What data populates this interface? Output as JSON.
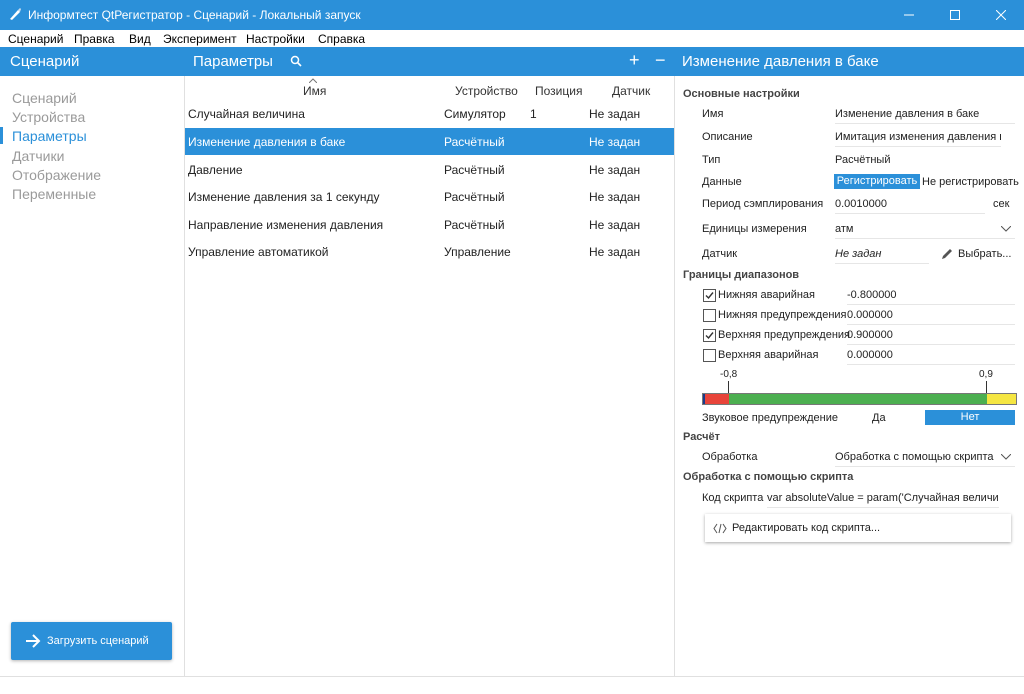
{
  "window": {
    "title": "Информтест QtРегистратор - Сценарий - Локальный запуск"
  },
  "menu": [
    "Сценарий",
    "Правка",
    "Вид",
    "Эксперимент",
    "Настройки",
    "Справка"
  ],
  "header": {
    "left_title": "Сценарий",
    "middle_title": "Параметры",
    "right_title": "Изменение давления в баке",
    "add_symbol": "+",
    "remove_symbol": "−"
  },
  "sidebar": {
    "items": [
      {
        "label": "Сценарий",
        "active": false
      },
      {
        "label": "Устройства",
        "active": false
      },
      {
        "label": "Параметры",
        "active": true
      },
      {
        "label": "Датчики",
        "active": false
      },
      {
        "label": "Отображение",
        "active": false
      },
      {
        "label": "Переменные",
        "active": false
      }
    ],
    "load_button": "Загрузить сценарий"
  },
  "table": {
    "columns": [
      "Имя",
      "Устройство",
      "Позиция",
      "Датчик"
    ],
    "rows": [
      {
        "name": "Случайная величина",
        "device": "Симулятор",
        "position": "1",
        "sensor": "Не задан",
        "selected": false
      },
      {
        "name": "Изменение давления в баке",
        "device": "Расчётный",
        "position": "",
        "sensor": "Не задан",
        "selected": true
      },
      {
        "name": "Давление",
        "device": "Расчётный",
        "position": "",
        "sensor": "Не задан",
        "selected": false
      },
      {
        "name": "Изменение давления за 1 секунду",
        "device": "Расчётный",
        "position": "",
        "sensor": "Не задан",
        "selected": false
      },
      {
        "name": "Направление изменения давления",
        "device": "Расчётный",
        "position": "",
        "sensor": "Не задан",
        "selected": false
      },
      {
        "name": "Управление автоматикой",
        "device": "Управление",
        "position": "",
        "sensor": "Не задан",
        "selected": false
      }
    ]
  },
  "details": {
    "basic": {
      "title": "Основные настройки",
      "name_label": "Имя",
      "name_value": "Изменение давления в баке",
      "desc_label": "Описание",
      "desc_value": "Имитация изменения давления в б",
      "type_label": "Тип",
      "type_value": "Расчётный",
      "data_label": "Данные",
      "data_on": "Регистрировать",
      "data_off": "Не регистрировать",
      "period_label": "Период сэмплирования",
      "period_value": "0.0010000",
      "period_unit": "сек",
      "units_label": "Единицы измерения",
      "units_value": "атм",
      "sensor_label": "Датчик",
      "sensor_value": "Не задан",
      "choose_label": "Выбрать..."
    },
    "ranges": {
      "title": "Границы диапазонов",
      "items": [
        {
          "label": "Нижняя аварийная",
          "checked": true,
          "value": "-0.800000"
        },
        {
          "label": "Нижняя предупреждения",
          "checked": false,
          "value": "0.000000"
        },
        {
          "label": "Верхняя предупреждения",
          "checked": true,
          "value": "0.900000"
        },
        {
          "label": "Верхняя аварийная",
          "checked": false,
          "value": "0.000000"
        }
      ],
      "scale_low": "-0,8",
      "scale_high": "0,9",
      "sound_label": "Звуковое предупреждение",
      "sound_yes": "Да",
      "sound_no": "Нет"
    },
    "calc": {
      "title": "Расчёт",
      "proc_label": "Обработка",
      "proc_value": "Обработка с помощью скрипта"
    },
    "script": {
      "title": "Обработка с помощью скрипта",
      "code_label": "Код скрипта",
      "code_value": "var absoluteValue = param('Случайная величина');",
      "edit_button": "Редактировать код скрипта..."
    }
  },
  "colors": {
    "accent": "#2b90d9",
    "scale_red": "#e8443a",
    "scale_green": "#4caf50",
    "scale_yellow": "#f5e642"
  }
}
